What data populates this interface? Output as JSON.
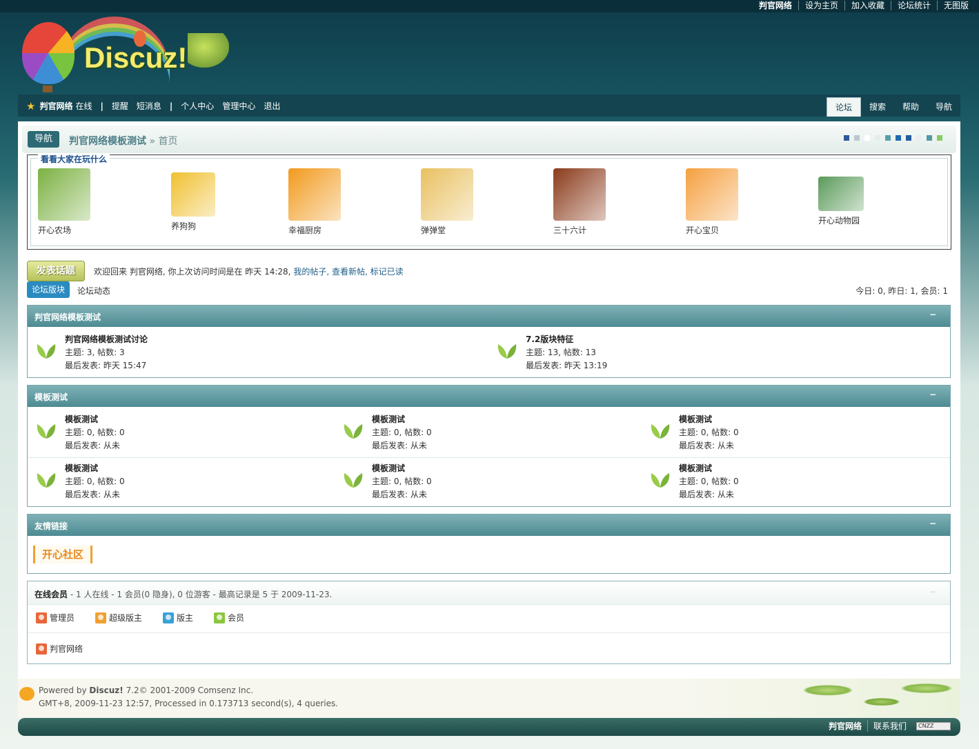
{
  "topbar": {
    "links": [
      "判官网络",
      "设为主页",
      "加入收藏",
      "论坛统计",
      "无图版"
    ]
  },
  "logo": {
    "text": "Discuz!"
  },
  "navbar": {
    "username": "判官网络",
    "status": "在线",
    "remind": "提醒",
    "sms": "短消息",
    "profile": "个人中心",
    "admin": "管理中心",
    "logout": "退出",
    "tabs": [
      "论坛",
      "搜索",
      "帮助",
      "导航"
    ]
  },
  "breadcrumb": {
    "nav_button": "导航",
    "site": "判官网络模板测试",
    "separator": "»",
    "current": "首页",
    "swatches": [
      "#2d5a9a",
      "#bfc6cc",
      "#ffffff",
      "#e5ecec",
      "#5a9ea7",
      "#1f6bb0",
      "#235c9c",
      "#e8eef0",
      "#4f9aa3",
      "#88cc66"
    ]
  },
  "games": {
    "legend": "看看大家在玩什么",
    "items": [
      {
        "label": "开心农场",
        "color": "#7bb142"
      },
      {
        "label": "养狗狗",
        "color": "#f0c030"
      },
      {
        "label": "幸福厨房",
        "color": "#f29a1e"
      },
      {
        "label": "弹弹堂",
        "color": "#e8c060"
      },
      {
        "label": "三十六计",
        "color": "#8a3a1a"
      },
      {
        "label": "开心宝贝",
        "color": "#f5a040"
      },
      {
        "label": "开心动物园",
        "color": "#5a9a5a"
      }
    ]
  },
  "welcome": {
    "post_button": "发表话题",
    "text": "欢迎回来 判官网络, 你上次访问时间是在 昨天 14:28,",
    "my_posts": "我的帖子,",
    "new_posts": "查看新帖,",
    "mark_read": "标记已读"
  },
  "tabs": {
    "forum": "论坛版块",
    "dynamic": "论坛动态",
    "stats": "今日: 0, 昨日: 1, 会员: 1"
  },
  "categories": [
    {
      "title": "判官网络模板测试",
      "toggle": "−",
      "forums": [
        {
          "name": "判官网络模板测试讨论",
          "counts": "主题: 3, 帖数: 3",
          "last": "最后发表: 昨天 15:47"
        },
        {
          "name": "7.2版块特征",
          "counts": "主题: 13, 帖数: 13",
          "last": "最后发表: 昨天 13:19"
        }
      ]
    },
    {
      "title": "模板测试",
      "toggle": "−",
      "forums": [
        {
          "name": "模板测试",
          "counts": "主题: 0, 帖数: 0",
          "last": "最后发表: 从未"
        },
        {
          "name": "模板测试",
          "counts": "主题: 0, 帖数: 0",
          "last": "最后发表: 从未"
        },
        {
          "name": "模板测试",
          "counts": "主题: 0, 帖数: 0",
          "last": "最后发表: 从未"
        },
        {
          "name": "模板测试",
          "counts": "主题: 0, 帖数: 0",
          "last": "最后发表: 从未"
        },
        {
          "name": "模板测试",
          "counts": "主题: 0, 帖数: 0",
          "last": "最后发表: 从未"
        },
        {
          "name": "模板测试",
          "counts": "主题: 0, 帖数: 0",
          "last": "最后发表: 从未"
        }
      ]
    },
    {
      "title": "友情链接",
      "toggle": "−",
      "logo_text": "开心社区"
    }
  ],
  "online": {
    "title": "在线会员",
    "summary": "- 1 人在线 - 1 会员(0 隐身), 0 位游客 - 最高记录是 5 于 2009-11-23.",
    "toggle": "−",
    "legend": [
      {
        "label": "管理员",
        "color": "#e8663a"
      },
      {
        "label": "超级版主",
        "color": "#f0a030"
      },
      {
        "label": "版主",
        "color": "#3aa0d8"
      },
      {
        "label": "会员",
        "color": "#8cc63f"
      }
    ],
    "user": "判官网络",
    "user_color": "#e8663a"
  },
  "footer": {
    "powered_prefix": "Powered by",
    "brand": "Discuz!",
    "powered_suffix": "7.2© 2001-2009 Comsenz Inc.",
    "line2": "GMT+8, 2009-11-23 12:57, Processed in 0.173713 second(s), 4 queries."
  },
  "bottombar": {
    "links": [
      "判官网络",
      "联系我们"
    ],
    "badge": "CNZZ"
  }
}
